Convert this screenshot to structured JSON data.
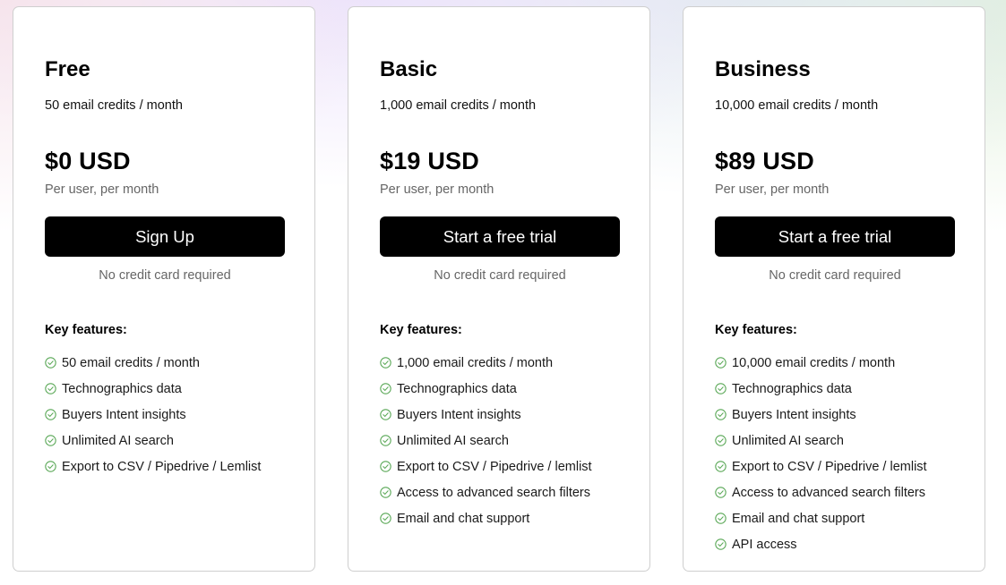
{
  "plans": [
    {
      "name": "Free",
      "credits": "50 email credits / month",
      "price": "$0 USD",
      "price_note": "Per user, per month",
      "cta": "Sign Up",
      "cta_note": "No credit card required",
      "features_heading": "Key features:",
      "features": [
        "50 email credits / month",
        "Technographics data",
        "Buyers Intent insights",
        "Unlimited AI search",
        "Export to CSV / Pipedrive / Lemlist"
      ]
    },
    {
      "name": "Basic",
      "credits": "1,000 email credits / month",
      "price": "$19 USD",
      "price_note": "Per user, per month",
      "cta": "Start a free trial",
      "cta_note": "No credit card required",
      "features_heading": "Key features:",
      "features": [
        "1,000 email credits / month",
        "Technographics data",
        "Buyers Intent insights",
        "Unlimited AI search",
        "Export to CSV / Pipedrive / lemlist",
        "Access to advanced search filters",
        "Email and chat support"
      ]
    },
    {
      "name": "Business",
      "credits": "10,000 email credits / month",
      "price": "$89 USD",
      "price_note": "Per user, per month",
      "cta": "Start a free trial",
      "cta_note": "No credit card required",
      "features_heading": "Key features:",
      "features": [
        "10,000 email credits / month",
        "Technographics data",
        "Buyers Intent insights",
        "Unlimited AI search",
        "Export to CSV / Pipedrive / lemlist",
        "Access to advanced search filters",
        "Email and chat support",
        "API access"
      ]
    }
  ],
  "icons": {
    "feature_check": "circle-check-icon"
  },
  "colors": {
    "check_green": "#5aa857",
    "button_bg": "#000000",
    "button_text": "#ffffff",
    "muted_text": "#666666",
    "card_border": "#cfcfcf"
  }
}
